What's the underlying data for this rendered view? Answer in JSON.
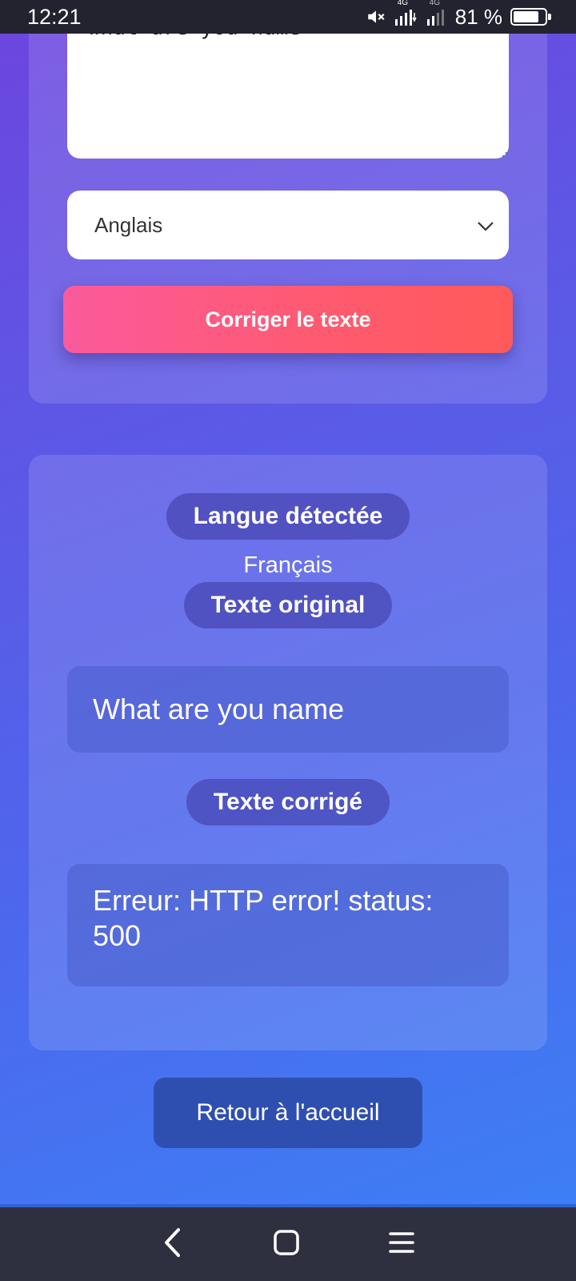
{
  "status_bar": {
    "time": "12:21",
    "network_1": "4G",
    "network_2": "4G",
    "battery_percent_label": "81 %",
    "battery_level": 0.81,
    "icons": [
      "mute-icon",
      "signal-icon",
      "signal-icon",
      "battery-icon"
    ]
  },
  "form": {
    "input_text": "what are you name",
    "language_select": {
      "selected": "Anglais"
    },
    "submit_label": "Corriger le texte"
  },
  "result": {
    "detected_language_heading": "Langue détectée",
    "detected_language_value": "Français",
    "original_heading": "Texte original",
    "original_text": "What are you name",
    "corrected_heading": "Texte corrigé",
    "corrected_text": "Erreur: HTTP error! status: 500"
  },
  "home_button_label": "Retour à l'accueil",
  "nav_bar": {
    "icons": [
      "back-icon",
      "home-icon",
      "menu-icon"
    ]
  },
  "colors": {
    "button_gradient_start": "#fb5a9c",
    "button_gradient_end": "#ff5a5a",
    "home_button": "#2f4fb0",
    "background_start": "#6d45de",
    "background_end": "#3b82f6"
  }
}
